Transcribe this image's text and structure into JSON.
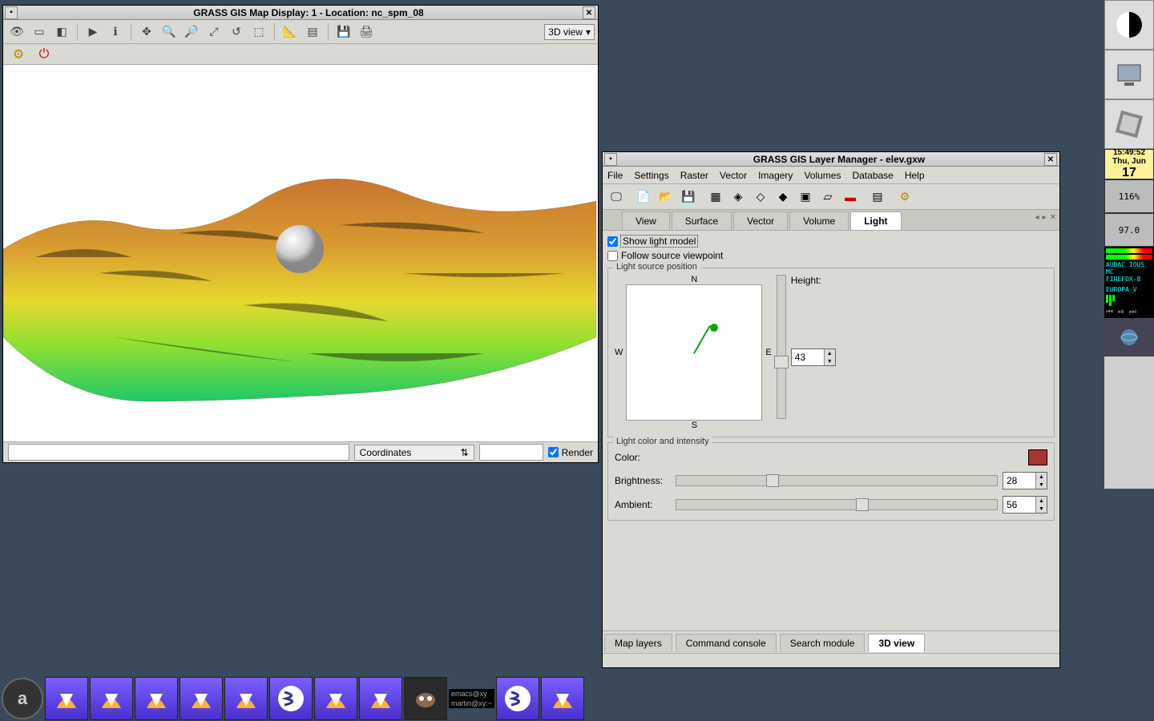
{
  "map_window": {
    "title": "GRASS GIS Map Display: 1  - Location: nc_spm_08",
    "viewmode": "3D view",
    "coord_label": "Coordinates",
    "render_label": "Render",
    "render_checked": true
  },
  "layer_window": {
    "title": "GRASS GIS Layer Manager - elev.gxw",
    "menus": [
      "File",
      "Settings",
      "Raster",
      "Vector",
      "Imagery",
      "Volumes",
      "Database",
      "Help"
    ],
    "tabs": [
      "View",
      "Surface",
      "Vector",
      "Volume",
      "Light"
    ],
    "active_tab": "Light",
    "show_light_model": {
      "label": "Show light model",
      "checked": true
    },
    "follow_viewpoint": {
      "label": "Follow source viewpoint",
      "checked": false
    },
    "light_pos_legend": "Light source position",
    "compass": {
      "n": "N",
      "s": "S",
      "e": "E",
      "w": "W"
    },
    "height_label": "Height:",
    "height_value": "43",
    "color_intensity_legend": "Light color and intensity",
    "color_label": "Color:",
    "color_value": "#a53a2a",
    "brightness_label": "Brightness:",
    "brightness_value": "28",
    "ambient_label": "Ambient:",
    "ambient_value": "56",
    "bottom_tabs": [
      "Map layers",
      "Command console",
      "Search module",
      "3D view"
    ],
    "active_bottom_tab": "3D view"
  },
  "tray": {
    "time": "15:49:52",
    "date_line1": "Thu, Jun",
    "date_day": "17",
    "lcd1": "116%",
    "lcd2": "97.0",
    "meter_lines": [
      "AUDAC IOUS",
      "MC",
      "FIREFOX-8",
      "EUROPA_V"
    ]
  },
  "taskbar": {
    "labels": [
      "emacs@xy",
      "martin@xy:~"
    ]
  }
}
